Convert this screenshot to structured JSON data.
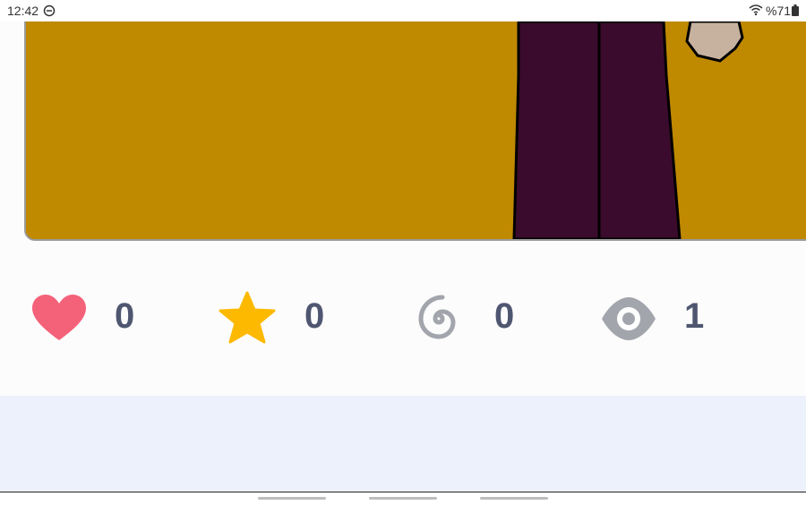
{
  "status_bar": {
    "time": "12:42",
    "battery_text": "%71"
  },
  "stats": {
    "likes": {
      "icon": "heart-icon",
      "count": "0",
      "color": "#f4627a"
    },
    "favorites": {
      "icon": "star-icon",
      "count": "0",
      "color": "#fdb900"
    },
    "remixes": {
      "icon": "swirl-icon",
      "count": "0",
      "color": "#a3a5ad"
    },
    "views": {
      "icon": "eye-icon",
      "count": "1",
      "color": "#a3a5ad"
    }
  },
  "colors": {
    "artwork_background": "#bf8900",
    "count_text": "#4f5670",
    "bottom_area": "#edf1fb"
  }
}
